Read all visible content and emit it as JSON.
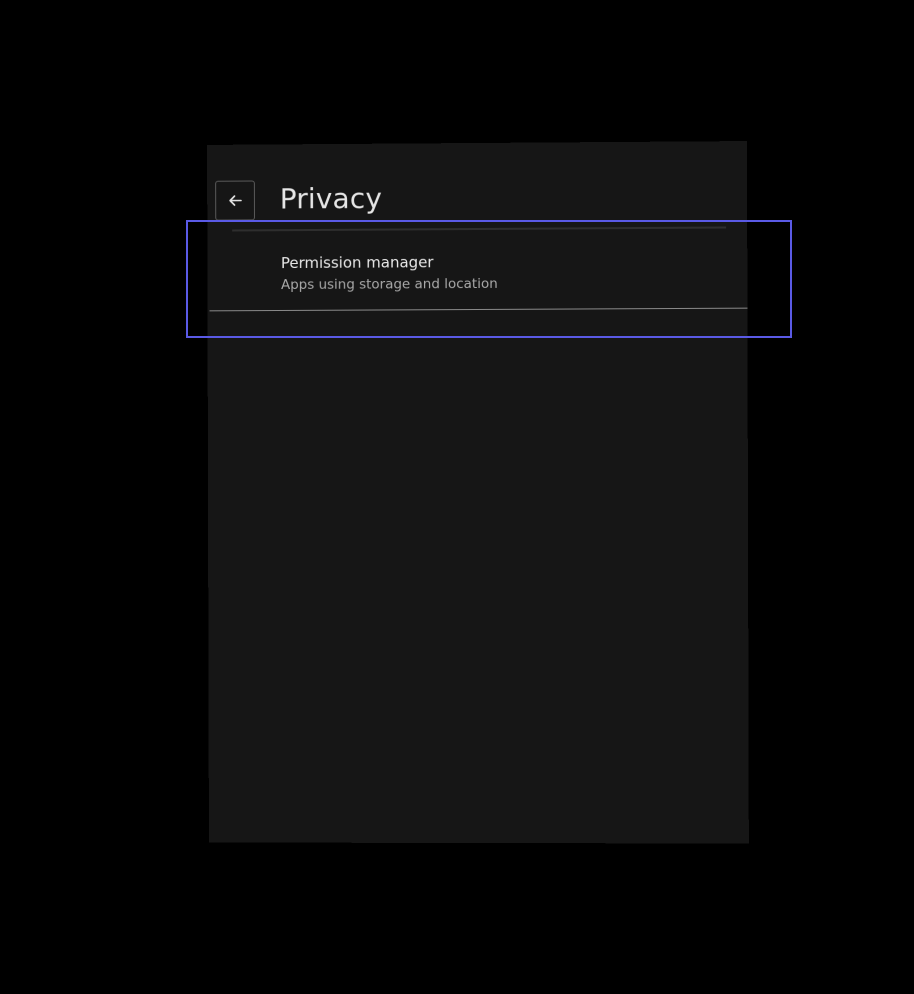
{
  "header": {
    "title": "Privacy",
    "back_icon": "arrow-left-icon"
  },
  "settings": {
    "items": [
      {
        "title": "Permission manager",
        "subtitle": "Apps using storage and location"
      }
    ]
  },
  "colors": {
    "page_background": "#000000",
    "panel_background": "#161616",
    "highlight_border": "#5a5ae6",
    "title_text": "#e6e6e6",
    "subtitle_text": "#a9a9a9"
  }
}
